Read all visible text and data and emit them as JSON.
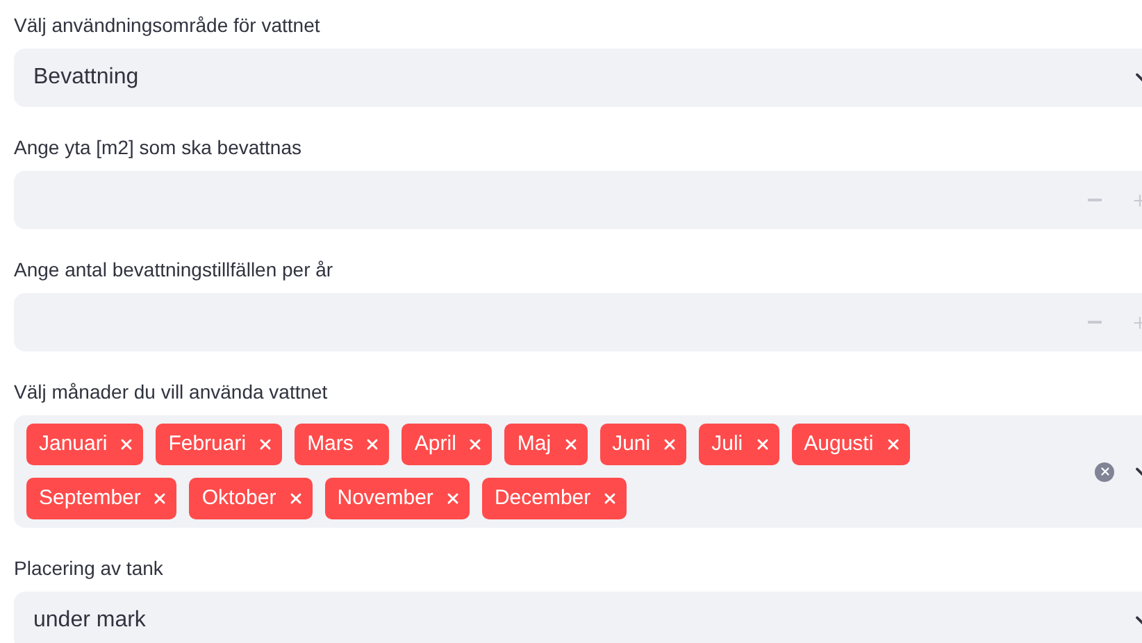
{
  "fields": [
    {
      "kind": "select",
      "label": "Välj användningsområde för vattnet",
      "value": "Bevattning"
    },
    {
      "kind": "number",
      "label": "Ange yta [m2] som ska bevattnas"
    },
    {
      "kind": "number",
      "label": "Ange antal bevattningstillfällen per år"
    },
    {
      "kind": "multiselect",
      "label": "Välj månader du vill använda vattnet",
      "tags": [
        "Januari",
        "Februari",
        "Mars",
        "April",
        "Maj",
        "Juni",
        "Juli",
        "Augusti",
        "September",
        "Oktober",
        "November",
        "December"
      ]
    },
    {
      "kind": "select",
      "label": "Placering av tank",
      "value": "under mark"
    }
  ]
}
